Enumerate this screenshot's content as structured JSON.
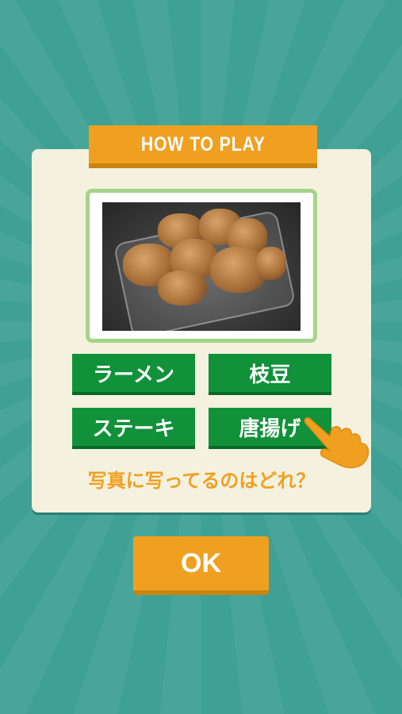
{
  "dialog": {
    "title": "HOW TO PLAY",
    "photo_icon": "fried-chicken-photo",
    "choices": [
      "ラーメン",
      "枝豆",
      "ステーキ",
      "唐揚げ"
    ],
    "question": "写真に写ってるのはどれ？",
    "pointer_icon": "pointing-hand-icon"
  },
  "ok_label": "OK",
  "colors": {
    "background": "#3fa095",
    "accent_orange": "#f0a020",
    "choice_green": "#10913a",
    "panel": "#f4f1df"
  }
}
